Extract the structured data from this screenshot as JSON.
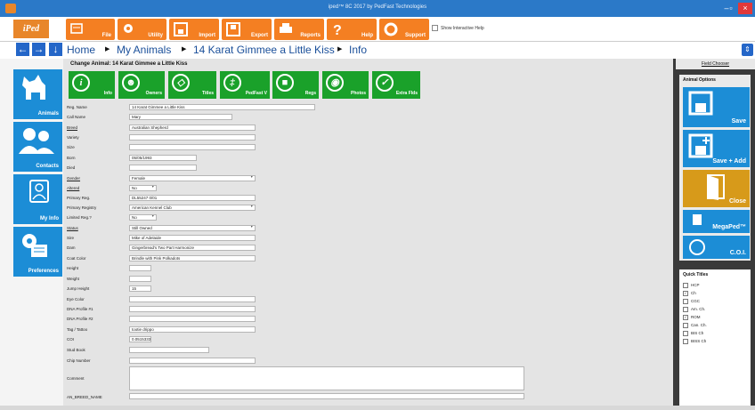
{
  "window": {
    "title": "iped™ 8C 2017 by PedFast Technologies"
  },
  "toolbar": {
    "logo": "iPed",
    "buttons": [
      {
        "label": "File",
        "icon": "file-icon"
      },
      {
        "label": "Utility",
        "icon": "gear-icon"
      },
      {
        "label": "Import",
        "icon": "import-icon"
      },
      {
        "label": "Export",
        "icon": "export-icon"
      },
      {
        "label": "Reports",
        "icon": "printer-icon"
      },
      {
        "label": "Help",
        "icon": "question-icon"
      },
      {
        "label": "Support",
        "icon": "support-icon"
      }
    ],
    "show_help_label": "Show Interactive Help"
  },
  "breadcrumb": [
    "Home",
    "My Animals",
    "14 Karat Gimmee a Little Kiss",
    "Info"
  ],
  "left_nav": [
    {
      "label": "Animals",
      "icon": "dog-icon"
    },
    {
      "label": "Contacts",
      "icon": "people-icon"
    },
    {
      "label": "My Info",
      "icon": "person-icon"
    },
    {
      "label": "Preferences",
      "icon": "preferences-icon"
    }
  ],
  "form": {
    "title": "Change Animal: 14 Karat Gimmee a Little Kiss",
    "tabs": [
      "Info",
      "Owners",
      "Titles",
      "PedFast V",
      "Regs",
      "Photos",
      "Extra Flds"
    ],
    "fields": [
      {
        "label": "Reg. Name",
        "value": "14 Karat Gimmee a Little Kiss"
      },
      {
        "label": "Call Name",
        "value": "Mary"
      },
      {
        "label": "Breed",
        "value": "Australian Shepherd"
      },
      {
        "label": "Variety",
        "value": ""
      },
      {
        "label": "Size",
        "value": ""
      },
      {
        "label": "Born",
        "value": "05/05/1993"
      },
      {
        "label": "Died",
        "value": ""
      },
      {
        "label": "Gender",
        "value": "Female"
      },
      {
        "label": "Altered",
        "value": "No"
      },
      {
        "label": "Primary Reg.",
        "value": "DL55247 0/01"
      },
      {
        "label": "Primary Registry",
        "value": "American Kennel Club"
      },
      {
        "label": "Limited Reg.?",
        "value": "No"
      },
      {
        "label": "Status",
        "value": "Still Owned"
      },
      {
        "label": "Sire",
        "value": "Mike of Adelaide"
      },
      {
        "label": "Dam",
        "value": "Gingerbread's Two Part Harmonize"
      },
      {
        "label": "Coat Color",
        "value": "Brindle with Pink Polkadots"
      },
      {
        "label": "Height",
        "value": ""
      },
      {
        "label": "Weight",
        "value": ""
      },
      {
        "label": "Jump Height",
        "value": "15"
      },
      {
        "label": "Eye Color",
        "value": ""
      },
      {
        "label": "DNA Profile #1",
        "value": ""
      },
      {
        "label": "DNA Profile #2",
        "value": ""
      },
      {
        "label": "Tag / Tattoo",
        "value": "tootie drippo"
      },
      {
        "label": "COI",
        "value": "0.0515333"
      },
      {
        "label": "Stud Book",
        "value": ""
      },
      {
        "label": "Chip Number",
        "value": ""
      },
      {
        "label": "Comment",
        "value": ""
      },
      {
        "label": "AN_BREED_NAME",
        "value": ""
      }
    ]
  },
  "right_panel": {
    "field_chooser": "Field Chooser",
    "animal_options_title": "Animal Options",
    "options": [
      {
        "label": "Save",
        "color": "#1c8dd6",
        "icon": "save-icon"
      },
      {
        "label": "Save + Add",
        "color": "#1c8dd6",
        "icon": "save-add-icon"
      },
      {
        "label": "Close",
        "color": "#d79a1a",
        "icon": "door-icon"
      },
      {
        "label": "MegaPed™",
        "color": "#1c8dd6",
        "icon": "document-icon"
      },
      {
        "label": "C.O.I.",
        "color": "#1c8dd6",
        "icon": "coi-icon"
      }
    ],
    "quick_titles_title": "Quick Titles",
    "quick_titles": [
      {
        "label": "HCP",
        "checked": false
      },
      {
        "label": "Ch",
        "checked": true
      },
      {
        "label": "CGC",
        "checked": false
      },
      {
        "label": "Am. Ch.",
        "checked": false
      },
      {
        "label": "ROM",
        "checked": true
      },
      {
        "label": "Can. Ch.",
        "checked": false
      },
      {
        "label": "BIS Ch",
        "checked": false
      },
      {
        "label": "BISS Ch",
        "checked": false
      }
    ]
  },
  "colors": {
    "toolbar": "#f47f22",
    "nav": "#2466c8",
    "sidebar": "#1c8dd6",
    "tabs": "#1aa12a",
    "close": "#d79a1a"
  }
}
